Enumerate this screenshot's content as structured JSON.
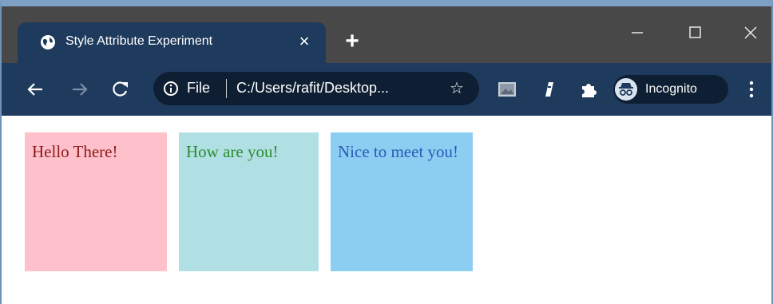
{
  "browser": {
    "tab": {
      "title": "Style Attribute Experiment"
    },
    "address_bar": {
      "scheme_label": "File",
      "url": "C:/Users/rafit/Desktop..."
    },
    "profile": {
      "label": "Incognito"
    }
  },
  "page": {
    "boxes": [
      {
        "text": "Hello There!",
        "background": "#fec0cb",
        "color": "#8b1a1a"
      },
      {
        "text": "How are you!",
        "background": "#b0e0e3",
        "color": "#2e8b2e"
      },
      {
        "text": "Nice to meet you!",
        "background": "#8ccdf2",
        "color": "#2a5ab7"
      }
    ]
  },
  "colors": {
    "titlebar": "#484848",
    "toolbar": "#1e3a5c",
    "omnibox": "#0f1f33"
  },
  "icons": [
    "globe-icon",
    "close-icon",
    "plus-icon",
    "minimize-icon",
    "maximize-icon",
    "window-close-icon",
    "back-arrow-icon",
    "forward-arrow-icon",
    "reload-icon",
    "info-icon",
    "star-icon",
    "image-extension-icon",
    "pen-extension-icon",
    "puzzle-icon",
    "incognito-icon",
    "kebab-menu-icon"
  ]
}
